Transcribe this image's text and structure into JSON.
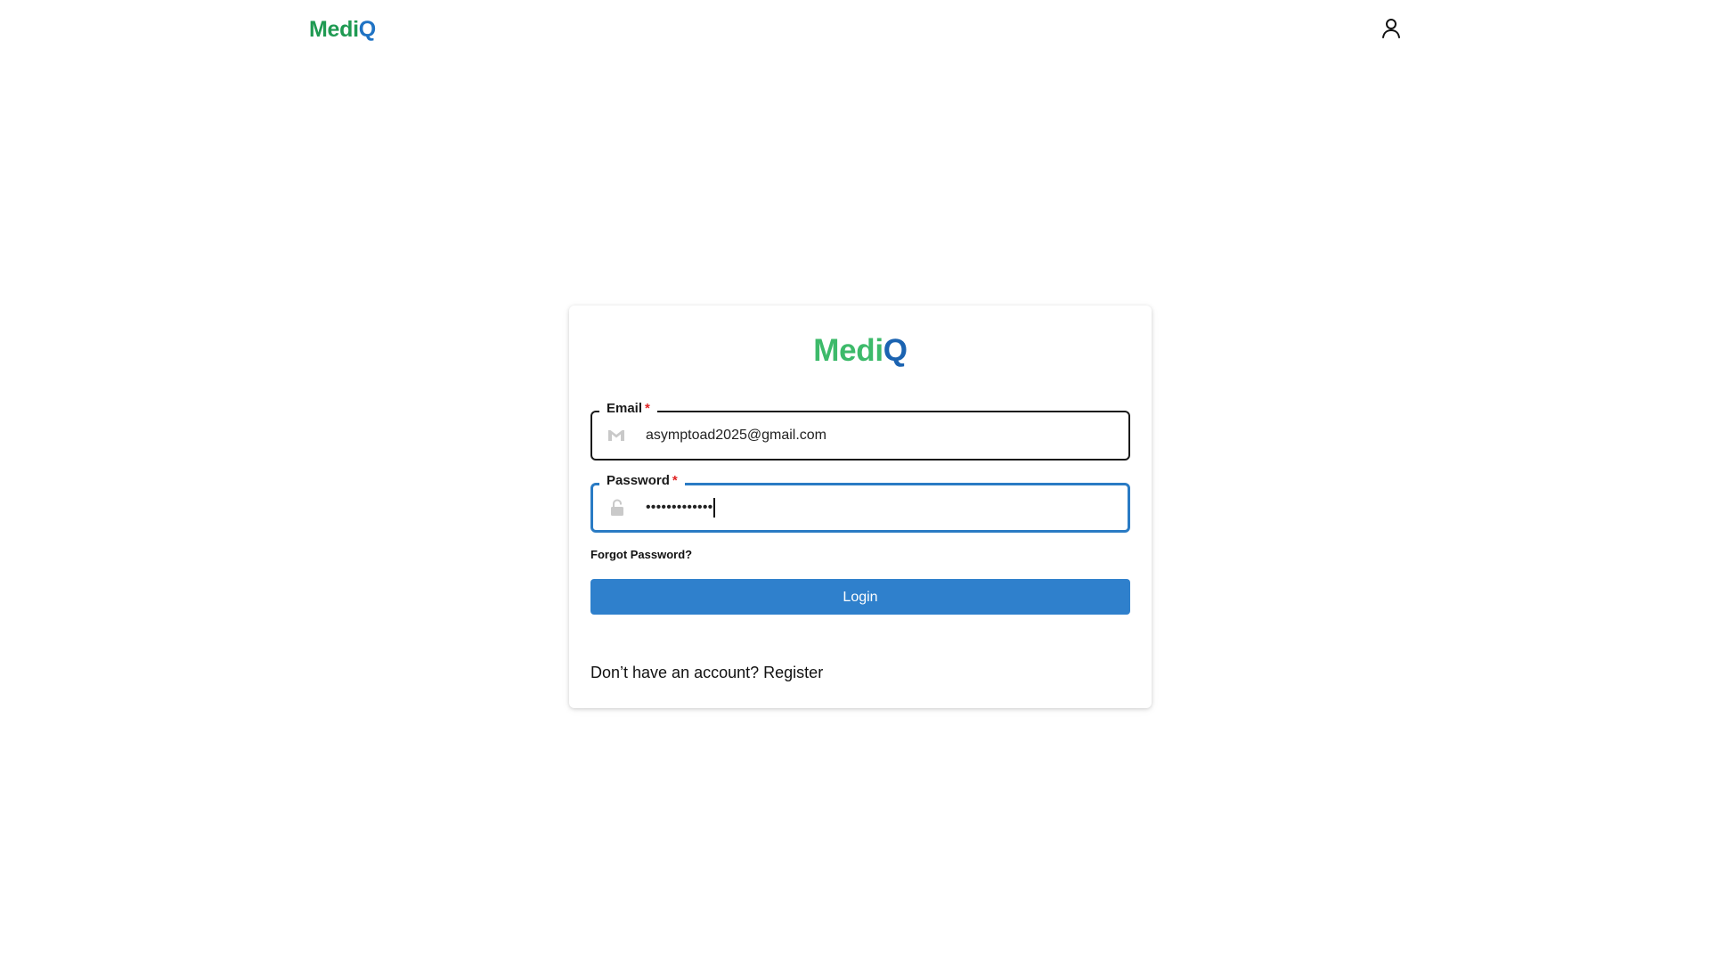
{
  "brand": {
    "part1": "Medi",
    "part2": "Q",
    "color_green": "#1f9a52",
    "color_blue": "#1f73c4"
  },
  "navbar": {
    "user_icon": "user-icon"
  },
  "login_card": {
    "logo_part1": "Medi",
    "logo_part2": "Q",
    "email": {
      "label": "Email",
      "required_mark": "*",
      "icon": "gmail-icon",
      "value": "asymptoad2025@gmail.com"
    },
    "password": {
      "label": "Password",
      "required_mark": "*",
      "icon": "lock-icon",
      "value_masked": "•••••••••••••"
    },
    "forgot_password": "Forgot Password?",
    "login_button": "Login",
    "register_prompt": "Don’t have an account?",
    "register_link": "Register",
    "accent_color": "#2f80cc",
    "focus_color": "#2a7bc4",
    "required_color": "#e02424"
  }
}
